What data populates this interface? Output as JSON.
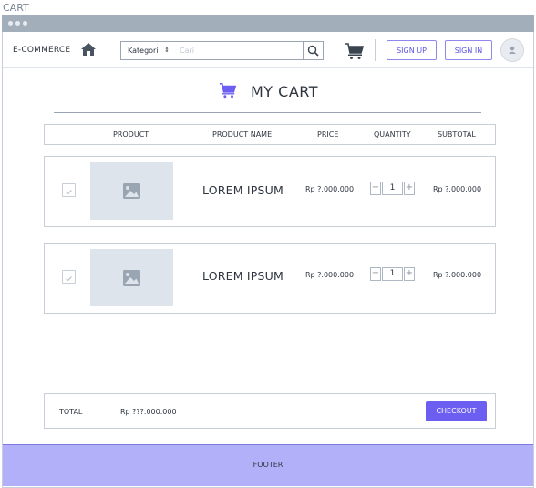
{
  "frame": {
    "label": "CART"
  },
  "header": {
    "brand": "E-COMMERCE",
    "category_select": "Kategori",
    "search_placeholder": "Cari",
    "sign_up": "SIGN UP",
    "sign_in": "SIGN IN"
  },
  "page": {
    "title": "MY CART"
  },
  "table": {
    "columns": [
      "PRODUCT",
      "PRODUCT NAME",
      "PRICE",
      "QUANTITY",
      "SUBTOTAL"
    ]
  },
  "items": [
    {
      "name": "LOREM IPSUM",
      "price": "Rp ?.000.000",
      "quantity": "1",
      "subtotal": "Rp ?.000.000",
      "checked": true
    },
    {
      "name": "LOREM IPSUM",
      "price": "Rp ?.000.000",
      "quantity": "1",
      "subtotal": "Rp ?.000.000",
      "checked": true
    }
  ],
  "summary": {
    "total_label": "TOTAL",
    "total_value": "Rp ???.000.000",
    "checkout": "CHECKOUT"
  },
  "footer": {
    "label": "FOOTER"
  },
  "colors": {
    "accent": "#6b5ef0",
    "footer_bg": "#b3b0fa",
    "chrome": "#a3aebb",
    "placeholder_img": "#dde4ec"
  },
  "icons": {
    "home": "home-icon",
    "search": "search-icon",
    "cart": "cart-icon",
    "avatar": "user-icon",
    "image": "image-placeholder-icon"
  }
}
